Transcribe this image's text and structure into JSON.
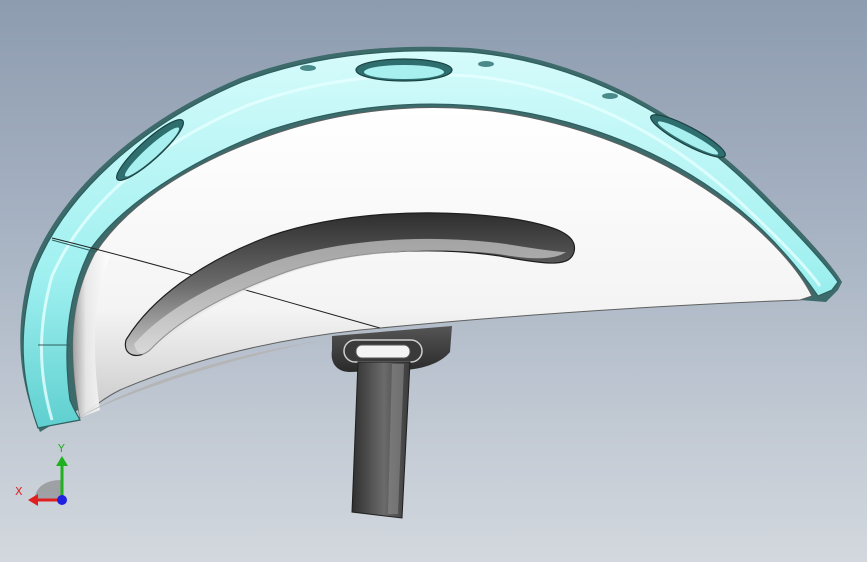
{
  "viewport": {
    "background_top": "#8e9cb0",
    "background_bottom": "#d3d8de"
  },
  "model": {
    "shell_accent": "#7fe3e3",
    "shell_fill": "#ffffff",
    "strap_color": "#4a4a4a"
  },
  "triad": {
    "x_label": "X",
    "y_label": "Y",
    "x_color": "#e02020",
    "y_color": "#20b020",
    "z_color": "#2020e0"
  }
}
